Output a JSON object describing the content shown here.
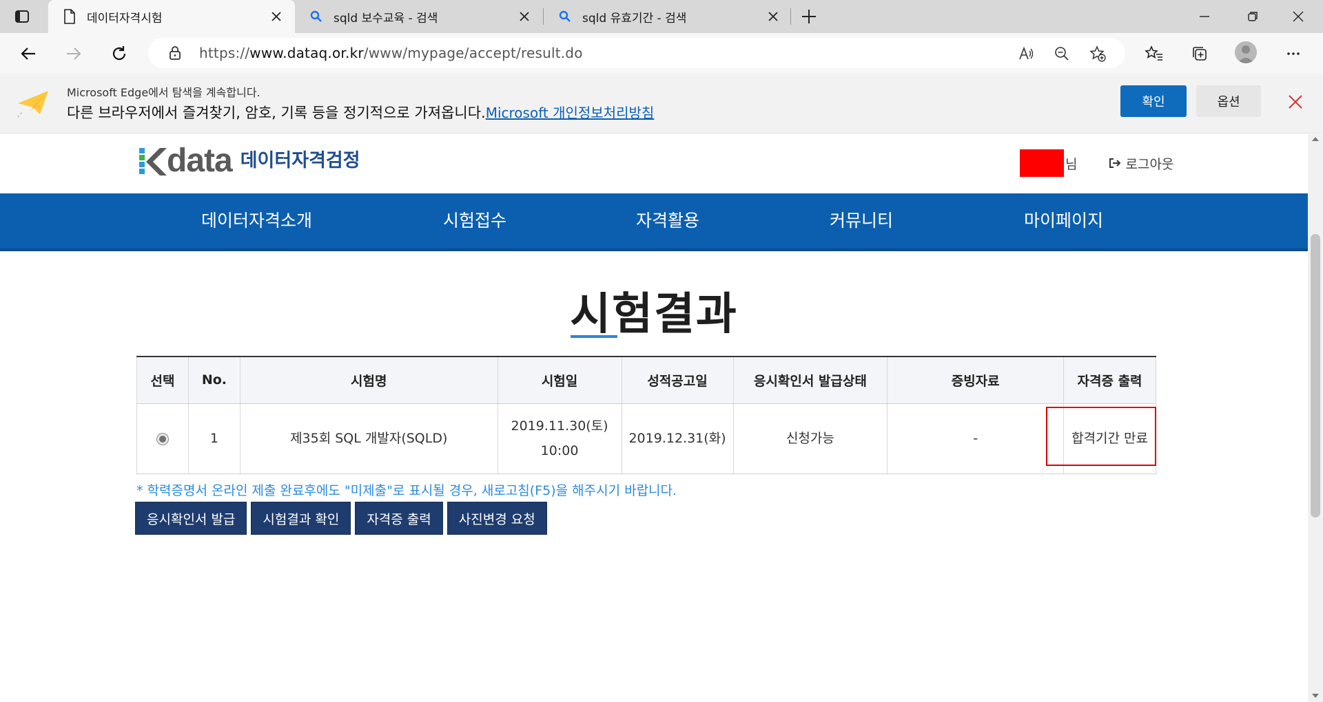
{
  "browser": {
    "tabs": [
      {
        "title": "데이터자격시험",
        "icon": "page-icon",
        "active": true
      },
      {
        "title": "sqld 보수교육 - 검색",
        "icon": "search-icon",
        "active": false
      },
      {
        "title": "sqld 유효기간 - 검색",
        "icon": "search-icon",
        "active": false
      }
    ],
    "url": {
      "scheme": "https://",
      "host": "www.dataq.or.kr",
      "path": "/www/mypage/accept/result.do"
    }
  },
  "infobar": {
    "line1": "Microsoft Edge에서 탐색을 계속합니다.",
    "line2": "다른 브라우저에서 즐겨찾기, 암호, 기록 등을 정기적으로 가져옵니다.",
    "link": "Microsoft 개인정보처리방침",
    "confirm_label": "확인",
    "options_label": "옵션"
  },
  "site": {
    "logo_word": "data",
    "logo_sub": "데이터자격검정",
    "user_suffix": "님",
    "logout_label": "로그아웃",
    "nav": [
      "데이터자격소개",
      "시험접수",
      "자격활용",
      "커뮤니티",
      "마이페이지"
    ],
    "brand_color": "#0c5fae"
  },
  "page": {
    "title": "시험결과",
    "table": {
      "headers": [
        "선택",
        "No.",
        "시험명",
        "시험일",
        "성적공고일",
        "응시확인서 발급상태",
        "증빙자료",
        "자격증 출력"
      ],
      "rows": [
        {
          "selected": true,
          "no": "1",
          "exam_name": "제35회 SQL 개발자(SQLD)",
          "exam_date_line1": "2019.11.30(토)",
          "exam_date_line2": "10:00",
          "result_date": "2019.12.31(화)",
          "issue_status": "신청가능",
          "evidence": "-",
          "certificate": "합격기간 만료"
        }
      ]
    },
    "notice": "* 학력증명서 온라인 제출 완료후에도 \"미제출\"로 표시될 경우, 새로고침(F5)을 해주시기 바랍니다.",
    "buttons": [
      "응시확인서 발급",
      "시험결과 확인",
      "자격증 출력",
      "사진변경 요청"
    ]
  }
}
